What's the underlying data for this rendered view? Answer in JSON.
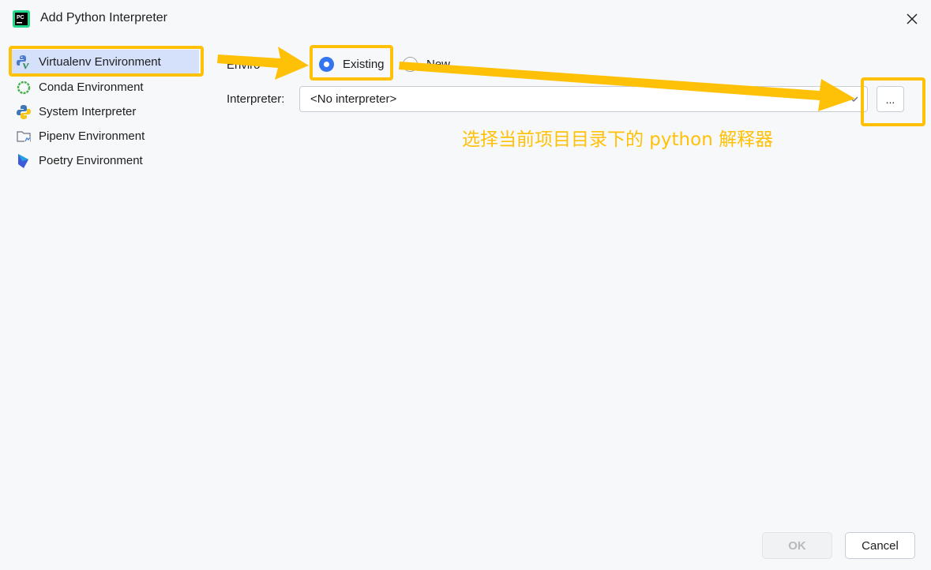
{
  "window": {
    "title": "Add Python Interpreter",
    "app_icon": "pycharm-icon",
    "app_icon_text": "PC"
  },
  "sidebar": {
    "items": [
      {
        "label": "Virtualenv Environment",
        "icon": "virtualenv-icon",
        "selected": true
      },
      {
        "label": "Conda Environment",
        "icon": "conda-icon",
        "selected": false
      },
      {
        "label": "System Interpreter",
        "icon": "python-icon",
        "selected": false
      },
      {
        "label": "Pipenv Environment",
        "icon": "pipenv-folder-icon",
        "selected": false
      },
      {
        "label": "Poetry Environment",
        "icon": "poetry-icon",
        "selected": false
      }
    ]
  },
  "form": {
    "environment_label": "Enviro",
    "radio_existing": "Existing",
    "radio_new": "New",
    "selected_option": "Existing",
    "interpreter_label": "Interpreter:",
    "interpreter_value": "<No interpreter>",
    "browse_label": "..."
  },
  "annotation": {
    "text": "选择当前项目目录下的 python 解释器",
    "color": "#ffc107"
  },
  "footer": {
    "ok_label": "OK",
    "cancel_label": "Cancel"
  },
  "colors": {
    "accent": "#3574f0",
    "selection": "#d5e1fb",
    "highlight": "#ffc107"
  }
}
